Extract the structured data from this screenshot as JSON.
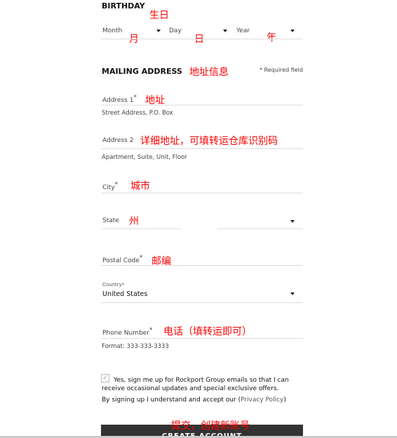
{
  "birthday": {
    "title": "BIRTHDAY",
    "note": "生日",
    "month": "Month",
    "month_note": "月",
    "day": "Day",
    "day_note": "日",
    "year": "Year",
    "year_note": "年"
  },
  "mailing": {
    "title": "MAILING ADDRESS",
    "note": "地址信息",
    "required": "* Required field"
  },
  "fields": {
    "address1": {
      "label": "Address 1",
      "note": "地址",
      "help": "Street Address, P.O. Box"
    },
    "address2": {
      "label": "Address 2",
      "note": "详细地址，可填转运仓库识别码",
      "help": "Apartment, Suite, Unit, Floor"
    },
    "city": {
      "label": "City",
      "note": "城市"
    },
    "state": {
      "label": "State",
      "note": "州"
    },
    "postal": {
      "label": "Postal Code",
      "note": "邮编"
    },
    "country": {
      "label": "Country",
      "value": "United States"
    },
    "phone": {
      "label": "Phone Number",
      "note": "电话（填转运即可）",
      "help": "Format: 333-333-3333"
    }
  },
  "asterisk": "*",
  "optin": {
    "checked": true,
    "text": "Yes, sign me up for Rockport Group emails so that I can receive occasional updates and special exclusive offers."
  },
  "terms": {
    "prefix": "By signing up I understand and accept our (",
    "link": "Privacy Policy",
    "suffix": ")"
  },
  "submit": {
    "label": "CREATE ACCOUNT",
    "note": "提交，创建新账号"
  }
}
